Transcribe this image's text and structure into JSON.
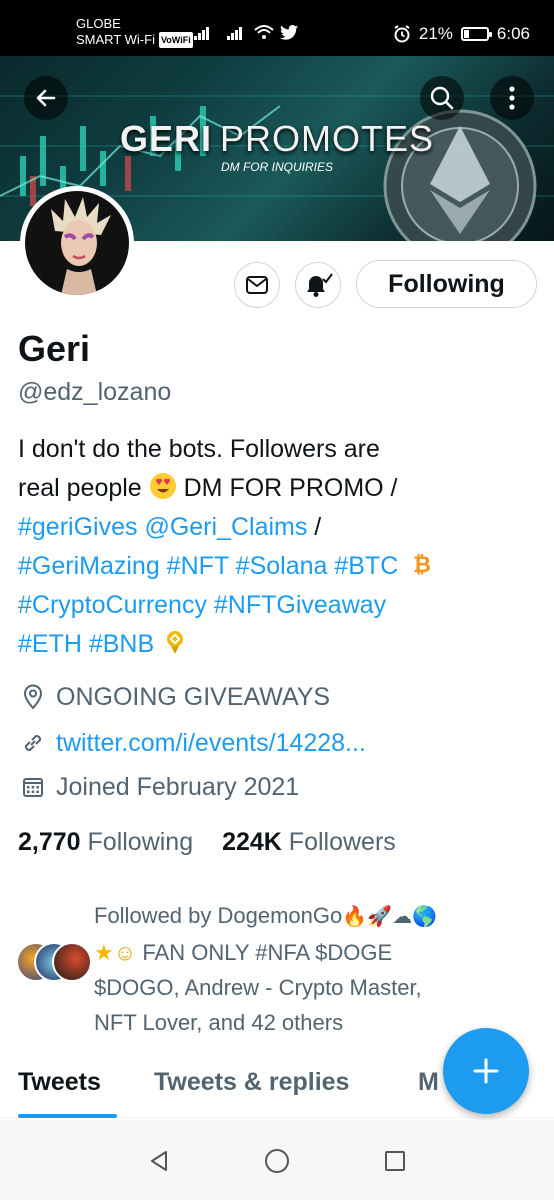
{
  "status_bar": {
    "carrier_line1": "GLOBE",
    "carrier_line2": "SMART Wi-Fi",
    "volte_badge": "VoWiFi",
    "battery": "21%",
    "battery_level": 0.21,
    "time": "6:06",
    "icons": [
      "signal-icon",
      "signal-icon",
      "wifi-icon",
      "twitter-bird-icon",
      "alarm-icon",
      "battery-icon"
    ]
  },
  "header": {
    "back_icon": "arrow-left-icon",
    "search_icon": "search-icon",
    "more_icon": "more-vertical-icon",
    "banner_title_word1": "GERI",
    "banner_title_word2": "PROMOTES",
    "banner_subtitle": "DM FOR INQUIRIES"
  },
  "profile": {
    "name": "Geri",
    "handle": "@edz_lozano",
    "bio": {
      "l1": "I don't do the bots. Followers are",
      "l2_text": "real people",
      "l2_emoji": "heart-eyes-emoji",
      "l2_rest": " DM FOR PROMO /",
      "l3_tag": "#geriGives",
      "l3_mention": "@Geri_Claims",
      "l3_rest": " /",
      "l4_tags": "#GeriMazing #NFT #Solana #BTC",
      "l4_emoji": "bitcoin-icon",
      "l5_tags": "#CryptoCurrency #NFTGiveaway",
      "l6_tags": "#ETH #BNB",
      "l6_emoji": "bnb-medal-icon"
    },
    "location": "ONGOING GIVEAWAYS",
    "website": "twitter.com/i/events/14228...",
    "joined": "Joined February 2021",
    "following_count": "2,770",
    "following_label": "Following",
    "followers_count": "224K",
    "followers_label": "Followers",
    "followed_by": {
      "line1": "Followed by DogemonGo",
      "line1_emojis": [
        "fire-emoji",
        "rocket-emoji",
        "cloud-emoji",
        "globe-emoji"
      ],
      "line2_emojis": [
        "star-emoji",
        "smile-emoji"
      ],
      "line2": " FAN ONLY #NFA $DOGE",
      "line3": "$DOGO, Andrew - Crypto Master,",
      "line4": "NFT Lover, and 42 others"
    }
  },
  "actions": {
    "message_icon": "mail-icon",
    "notify_icon": "bell-check-icon",
    "following_button": "Following"
  },
  "tabs": [
    {
      "label": "Tweets",
      "active": true
    },
    {
      "label": "Tweets & replies",
      "active": false
    },
    {
      "label": "M",
      "active": false
    }
  ],
  "fab": {
    "icon": "plus-icon"
  },
  "colors": {
    "accent": "#1d9bf0",
    "text": "#0f1419",
    "secondary": "#536471"
  }
}
